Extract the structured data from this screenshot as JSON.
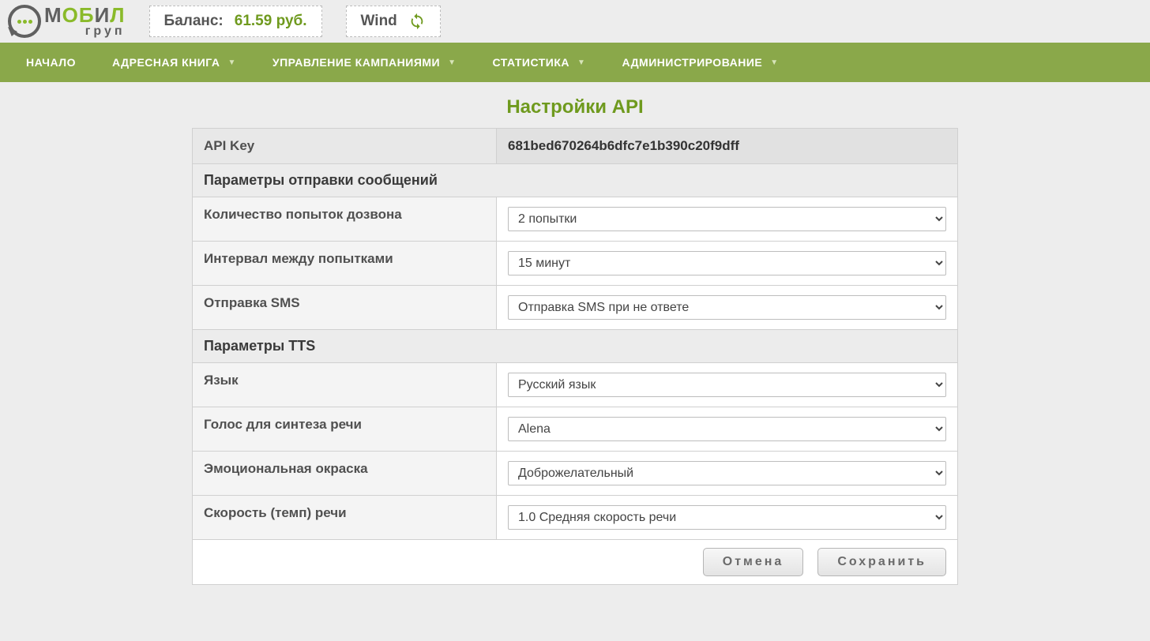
{
  "header": {
    "balance_label": "Баланс: ",
    "balance_amount": "61.59 руб.",
    "wind_label": "Wind"
  },
  "nav": {
    "items": [
      {
        "label": "НАЧАЛО",
        "dropdown": false
      },
      {
        "label": "АДРЕСНАЯ КНИГА",
        "dropdown": true
      },
      {
        "label": "УПРАВЛЕНИЕ КАМПАНИЯМИ",
        "dropdown": true
      },
      {
        "label": "СТАТИСТИКА",
        "dropdown": true
      },
      {
        "label": "АДМИНИСТРИРОВАНИЕ",
        "dropdown": true
      }
    ]
  },
  "page": {
    "title": "Настройки API"
  },
  "form": {
    "api_key_label": "API Key",
    "api_key_value": "681bed670264b6dfc7e1b390c20f9dff",
    "section_send": "Параметры отправки сообщений",
    "attempts_label": "Количество попыток дозвона",
    "attempts_value": "2 попытки",
    "interval_label": "Интервал между попытками",
    "interval_value": "15 минут",
    "sms_label": "Отправка SMS",
    "sms_value": "Отправка SMS при не ответе",
    "section_tts": "Параметры TTS",
    "lang_label": "Язык",
    "lang_value": "Русский язык",
    "voice_label": "Голос для синтеза речи",
    "voice_value": "Alena",
    "emotion_label": "Эмоциональная окраска",
    "emotion_value": "Доброжелательный",
    "speed_label": "Скорость (темп) речи",
    "speed_value": "1.0 Средняя скорость речи"
  },
  "buttons": {
    "cancel": "Отмена",
    "save": "Сохранить"
  }
}
